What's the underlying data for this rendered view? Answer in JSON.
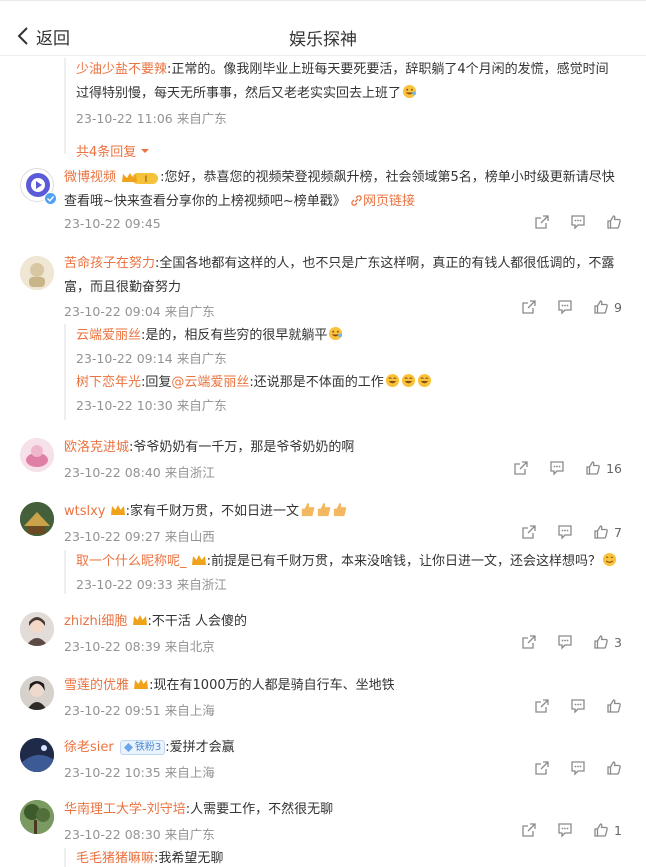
{
  "header": {
    "back_label": "返回",
    "title": "娱乐探神"
  },
  "thread0": {
    "reply_name": "少油少盐不要辣",
    "reply_text_1": ":正常的。像我刚毕业上班每天要死要活，辞职躺了4个月闲的发慌，感觉时间",
    "reply_text_2": "过得特别慢，每天无所事事，然后又老老实实回去上班了",
    "reply_meta": "23-10-22 11:06 来自广东",
    "more_label": "共4条回复"
  },
  "c1": {
    "name": "微博视频",
    "text_1": ":您好，恭喜您的视频荣登视频飙升榜，社会领域第5名，榜单小时级更新请尽快",
    "text_2": "查看哦~快来查看分享你的上榜视频吧~榜单戳》",
    "link_label": "网页链接",
    "meta": "23-10-22 09:45"
  },
  "c2": {
    "name": "苦命孩子在努力",
    "text_1": ":全国各地都有这样的人，也不只是广东这样啊，真正的有钱人都很低调的，不露",
    "text_2": "富，而且很勤奋努力",
    "meta": "23-10-22 09:04 来自广东",
    "likes": "9",
    "replies": [
      {
        "name": "云端爱丽丝",
        "text": ":是的，相反有些穷的很早就躺平",
        "meta": "23-10-22 09:14 来自广东"
      },
      {
        "name": "树下恋年光",
        "text_pre": ":回复",
        "mention": "@云端爱丽丝",
        "text": ":还说那是不体面的工作",
        "meta": "23-10-22 10:30 来自广东"
      }
    ]
  },
  "c3": {
    "name": "欧洛克进城",
    "text": ":爷爷奶奶有一千万，那是爷爷奶奶的啊",
    "meta": "23-10-22 08:40 来自浙江",
    "likes": "16"
  },
  "c4": {
    "name": "wtslxy",
    "text": ":家有千财万贯，不如日进一文",
    "meta": "23-10-22 09:27 来自山西",
    "likes": "7",
    "reply": {
      "name": "取一个什么昵称呢_",
      "text": ":前提是已有千财万贯，本来没啥钱，让你日进一文，还会这样想吗？",
      "meta": "23-10-22 09:33 来自浙江"
    }
  },
  "c5": {
    "name": "zhizhi细胞",
    "text": ":不干活 人会傻的",
    "meta": "23-10-22 08:39 来自北京",
    "likes": "3"
  },
  "c6": {
    "name": "雪莲的优雅",
    "text": ":现在有1000万的人都是骑自行车、坐地铁",
    "meta": "23-10-22 09:51 来自上海"
  },
  "c7": {
    "name": "徐老sier",
    "badge": "铁粉3",
    "text": ":爱拼才会赢",
    "meta": "23-10-22 10:35 来自上海"
  },
  "c8": {
    "name": "华南理工大学-刘守培",
    "text": ":人需要工作，不然很无聊",
    "meta": "23-10-22 08:30 来自广东",
    "likes": "1",
    "reply": {
      "name": "毛毛猪猪嘛嘛",
      "text": ":我希望无聊"
    }
  },
  "colors": {
    "name": "#eb7340",
    "meta": "#939393",
    "text": "#333333"
  }
}
